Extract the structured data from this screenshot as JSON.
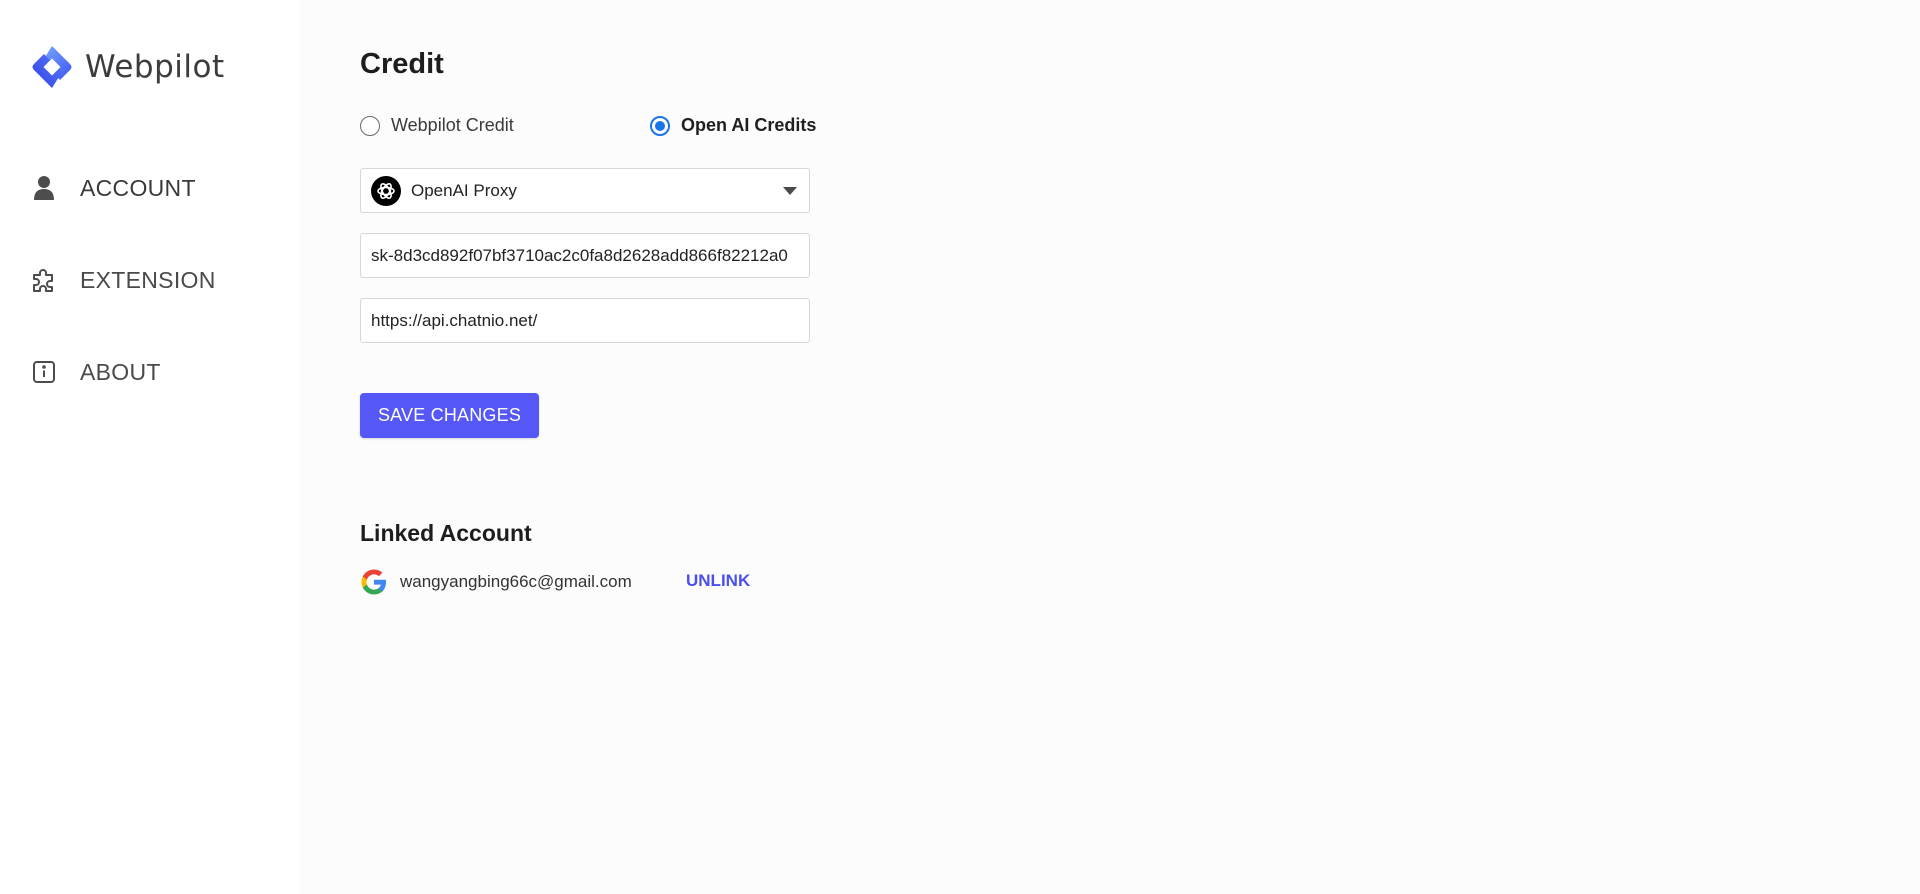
{
  "app": {
    "brand_name": "Webpilot",
    "colors": {
      "accent": "#5558f6",
      "link": "#4b4ff0",
      "radio_checked": "#1a73e8"
    }
  },
  "sidebar": {
    "items": [
      {
        "label": "ACCOUNT",
        "icon": "user-icon",
        "active": true
      },
      {
        "label": "EXTENSION",
        "icon": "puzzle-icon",
        "active": false
      },
      {
        "label": "ABOUT",
        "icon": "info-icon",
        "active": false
      }
    ]
  },
  "credit": {
    "title": "Credit",
    "options": [
      {
        "label": "Webpilot Credit",
        "checked": false
      },
      {
        "label": "Open AI Credits",
        "checked": true
      }
    ],
    "provider": {
      "selected": "OpenAI Proxy",
      "icon": "openai-icon"
    },
    "api_key": {
      "value": "sk-8d3cd892f07bf3710ac2c0fa8d2628add866f82212a0"
    },
    "api_url": {
      "value": "https://api.chatnio.net/"
    },
    "save_label": "SAVE CHANGES"
  },
  "linked_account": {
    "title": "Linked Account",
    "provider_icon": "google-icon",
    "email": "wangyangbing66c@gmail.com",
    "unlink_label": "UNLINK"
  }
}
